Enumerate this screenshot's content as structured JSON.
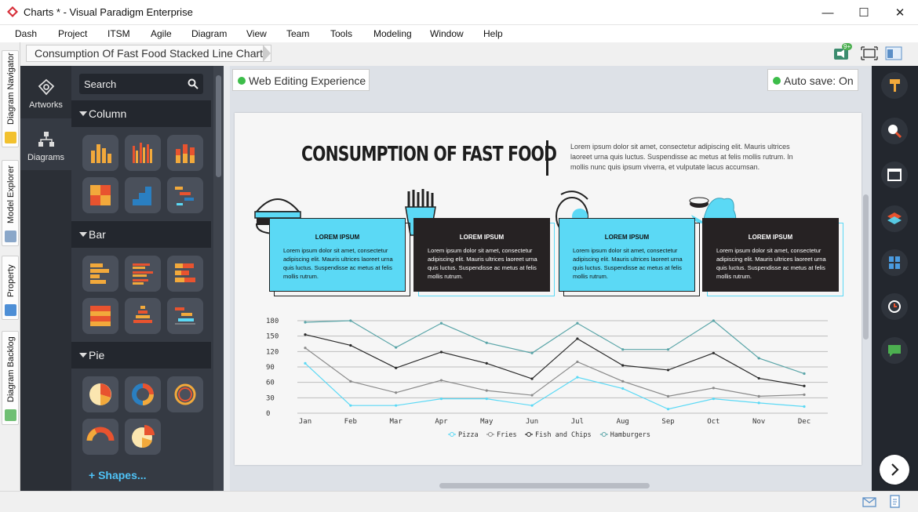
{
  "window": {
    "title": "Charts * - Visual Paradigm Enterprise",
    "minimize": "—",
    "maximize": "☐",
    "close": "✕"
  },
  "menu": [
    "Dash",
    "Project",
    "ITSM",
    "Agile",
    "Diagram",
    "View",
    "Team",
    "Tools",
    "Modeling",
    "Window",
    "Help"
  ],
  "left_tabs": [
    "Diagram Navigator",
    "Model Explorer",
    "Property",
    "Diagram Backlog"
  ],
  "breadcrumb": "Consumption Of Fast Food Stacked Line Chart",
  "notification_badge": "9+",
  "categories": [
    "Artworks",
    "Diagrams"
  ],
  "search": {
    "placeholder": "Search"
  },
  "sections": [
    "Column",
    "Bar",
    "Pie"
  ],
  "shapes_link": "+ Shapes...",
  "pills": {
    "web_editing": "Web Editing Experience",
    "autosave": "Auto save: On"
  },
  "doc": {
    "title": "CONSUMPTION OF FAST FOOD",
    "description": "Lorem ipsum dolor sit amet, consectetur adipiscing elit. Mauris ultrices laoreet urna quis luctus. Suspendisse ac metus at felis mollis rutrum. In mollis nunc quis ipsum viverra, et vulputate lacus accumsan.",
    "cards": [
      {
        "heading": "LOREM IPSUM",
        "text": "Lorem ipsum dolor sit amet, consectetur adipiscing elit. Mauris ultrices laoreet urna quis luctus. Suspendisse ac metus at felis mollis rutrum."
      },
      {
        "heading": "LOREM IPSUM",
        "text": "Lorem ipsum dolor sit amet, consectetur adipiscing elit. Mauris ultrices laoreet urna quis luctus. Suspendisse ac metus at felis mollis rutrum."
      },
      {
        "heading": "LOREM IPSUM",
        "text": "Lorem ipsum dolor sit amet, consectetur adipiscing elit. Mauris ultrices laoreet urna quis luctus. Suspendisse ac metus at felis mollis rutrum."
      },
      {
        "heading": "LOREM IPSUM",
        "text": "Lorem ipsum dolor sit amet, consectetur adipiscing elit. Mauris ultrices laoreet urna quis luctus. Suspendisse ac metus at felis mollis rutrum."
      }
    ]
  },
  "colors": {
    "accent_cyan": "#5bd9f5",
    "dark": "#262223",
    "online": "#3dbd4a"
  },
  "chart_data": {
    "type": "line",
    "title": "",
    "xlabel": "",
    "ylabel": "",
    "categories": [
      "Jan",
      "Feb",
      "Mar",
      "Apr",
      "May",
      "Jun",
      "Jul",
      "Aug",
      "Sep",
      "Oct",
      "Nov",
      "Dec"
    ],
    "y_ticks": [
      0,
      30,
      60,
      90,
      120,
      150,
      180
    ],
    "ylim": [
      0,
      180
    ],
    "grid": true,
    "legend": "bottom",
    "series": [
      {
        "name": "Pizza",
        "color": "#5bd9f5",
        "values": [
          97,
          15,
          15,
          28,
          28,
          15,
          70,
          48,
          8,
          28,
          20,
          13
        ]
      },
      {
        "name": "Fries",
        "color": "#8a8a8a",
        "values": [
          127,
          62,
          40,
          64,
          44,
          35,
          100,
          62,
          33,
          49,
          33,
          36
        ]
      },
      {
        "name": "Fish and Chips",
        "color": "#2b2b2b",
        "values": [
          153,
          132,
          88,
          119,
          97,
          67,
          145,
          93,
          84,
          117,
          68,
          53
        ]
      },
      {
        "name": "Hamburgers",
        "color": "#5aa5a8",
        "values": [
          177,
          180,
          128,
          175,
          137,
          117,
          175,
          124,
          124,
          180,
          107,
          77
        ]
      }
    ]
  }
}
